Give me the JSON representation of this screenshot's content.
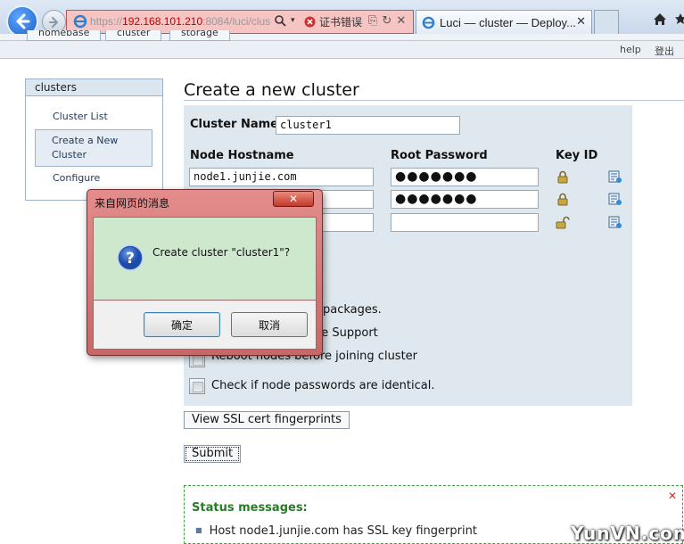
{
  "browser": {
    "url_scheme": "https://",
    "url_host": "192.168.101.210",
    "url_rest": ":8084/luci/clus",
    "cert_error": "证书错误",
    "tab_title": "Luci — cluster — Deploy..."
  },
  "topnav": {
    "tabs": [
      "homebase",
      "cluster",
      "storage"
    ]
  },
  "helpbar": {
    "help": "help",
    "logout": "登出"
  },
  "sidebar": {
    "header": "clusters",
    "items": [
      {
        "label": "Cluster List"
      },
      {
        "label": "Create a New Cluster"
      },
      {
        "label": "Configure"
      }
    ]
  },
  "page": {
    "title": "Create a new cluster",
    "cluster_name_label": "Cluster Name",
    "cluster_name_value": "cluster1",
    "col_hostname": "Node Hostname",
    "col_password": "Root Password",
    "col_keyid": "Key ID",
    "nodes": [
      {
        "hostname": "node1.junjie.com",
        "password": "●●●●●●●"
      },
      {
        "hostname": "",
        "password": "●●●●●●●"
      },
      {
        "hostname": "",
        "password": ""
      }
    ],
    "options": {
      "packages_partial": "packages.",
      "storage_partial": "ge Support",
      "reboot_partial": "Reboot nodes before joining cluster",
      "identical_pw": "Check if node passwords are identical."
    },
    "ssl_button": "View SSL cert fingerprints",
    "submit_button": "Submit",
    "status_title": "Status messages:",
    "status_line": "Host node1.junjie.com has SSL key fingerprint"
  },
  "dialog": {
    "title": "来自网页的消息",
    "message": "Create cluster \"cluster1\"?",
    "ok": "确定",
    "cancel": "取消"
  },
  "watermark": "YunVN.com"
}
